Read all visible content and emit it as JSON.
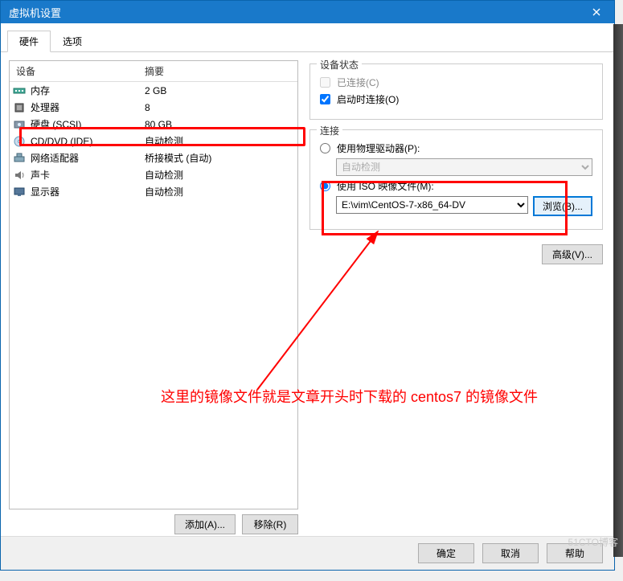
{
  "titlebar": {
    "title": "虚拟机设置"
  },
  "tabs": {
    "hardware": "硬件",
    "options": "选项"
  },
  "list_header": {
    "device": "设备",
    "summary": "摘要"
  },
  "devices": [
    {
      "icon": "memory-icon",
      "name": "内存",
      "summary": "2 GB"
    },
    {
      "icon": "cpu-icon",
      "name": "处理器",
      "summary": "8"
    },
    {
      "icon": "disk-icon",
      "name": "硬盘 (SCSI)",
      "summary": "80 GB"
    },
    {
      "icon": "cd-icon",
      "name": "CD/DVD (IDE)",
      "summary": "自动检测"
    },
    {
      "icon": "network-icon",
      "name": "网络适配器",
      "summary": "桥接模式 (自动)"
    },
    {
      "icon": "sound-icon",
      "name": "声卡",
      "summary": "自动检测"
    },
    {
      "icon": "display-icon",
      "name": "显示器",
      "summary": "自动检测"
    }
  ],
  "left_buttons": {
    "add": "添加(A)...",
    "remove": "移除(R)"
  },
  "device_status": {
    "title": "设备状态",
    "connected": "已连接(C)",
    "connect_at_power": "启动时连接(O)"
  },
  "connection": {
    "title": "连接",
    "use_physical": "使用物理驱动器(P):",
    "auto_detect": "自动检测",
    "use_iso": "使用 ISO 映像文件(M):",
    "iso_path": "E:\\vim\\CentOS-7-x86_64-DV",
    "browse": "浏览(B)..."
  },
  "advanced": "高级(V)...",
  "bottom": {
    "ok": "确定",
    "cancel": "取消",
    "help": "帮助"
  },
  "annotation": "这里的镜像文件就是文章开头时下载的 centos7 的镜像文件",
  "watermark": "51CTO博客"
}
